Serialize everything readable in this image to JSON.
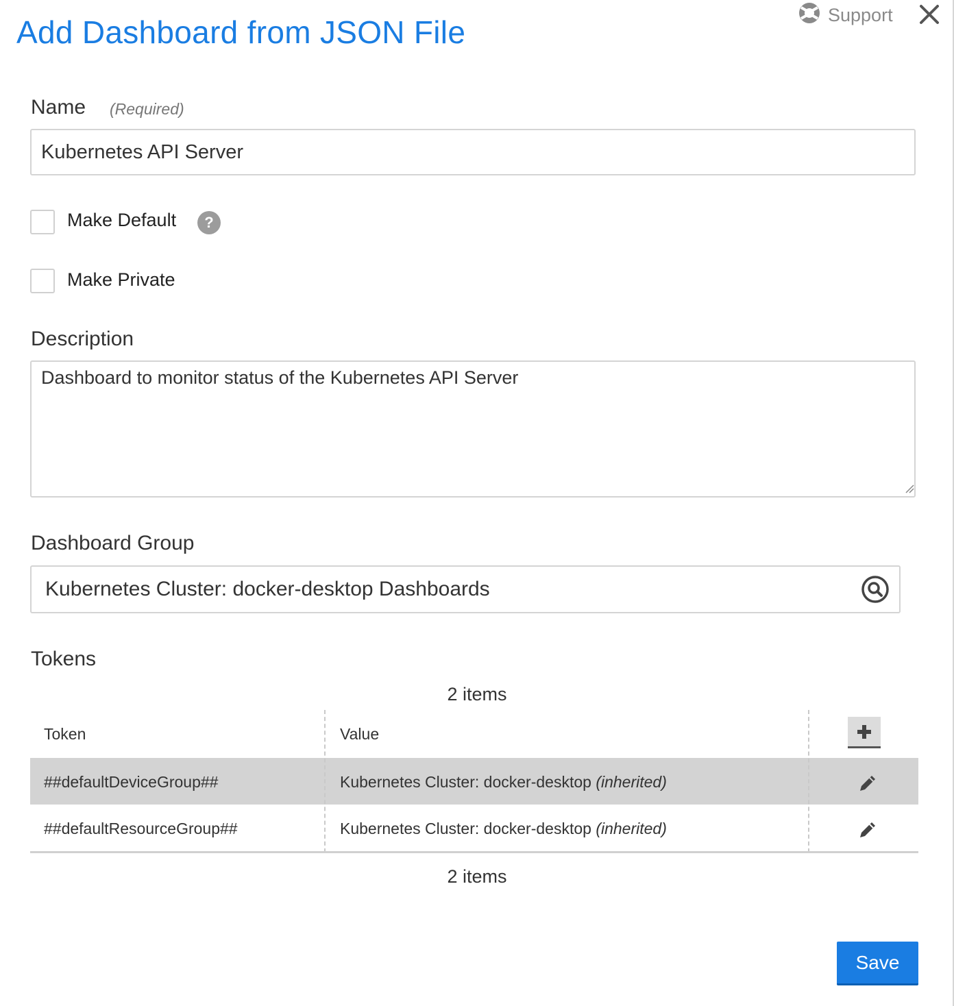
{
  "dialog": {
    "title": "Add Dashboard from JSON File",
    "support_label": "Support"
  },
  "form": {
    "name_label": "Name",
    "name_required": "(Required)",
    "name_value": "Kubernetes API Server",
    "make_default_label": "Make Default",
    "make_default_checked": false,
    "make_private_label": "Make Private",
    "make_private_checked": false,
    "description_label": "Description",
    "description_value": "Dashboard to monitor status of the Kubernetes API Server",
    "group_label": "Dashboard Group",
    "group_value": "Kubernetes Cluster: docker-desktop Dashboards"
  },
  "tokens": {
    "heading": "Tokens",
    "count_top": "2 items",
    "count_bottom": "2 items",
    "columns": {
      "token": "Token",
      "value": "Value"
    },
    "rows": [
      {
        "token": "##defaultDeviceGroup##",
        "value": "Kubernetes Cluster: docker-desktop",
        "suffix": "(inherited)",
        "selected": true
      },
      {
        "token": "##defaultResourceGroup##",
        "value": "Kubernetes Cluster: docker-desktop",
        "suffix": "(inherited)",
        "selected": false
      }
    ]
  },
  "actions": {
    "save_label": "Save"
  },
  "colors": {
    "accent": "#1a7de2",
    "selected_row": "#d3d3d3"
  },
  "icons": [
    "lifebuoy-icon",
    "close-icon",
    "question-icon",
    "search-icon",
    "plus-icon",
    "pencil-icon"
  ]
}
